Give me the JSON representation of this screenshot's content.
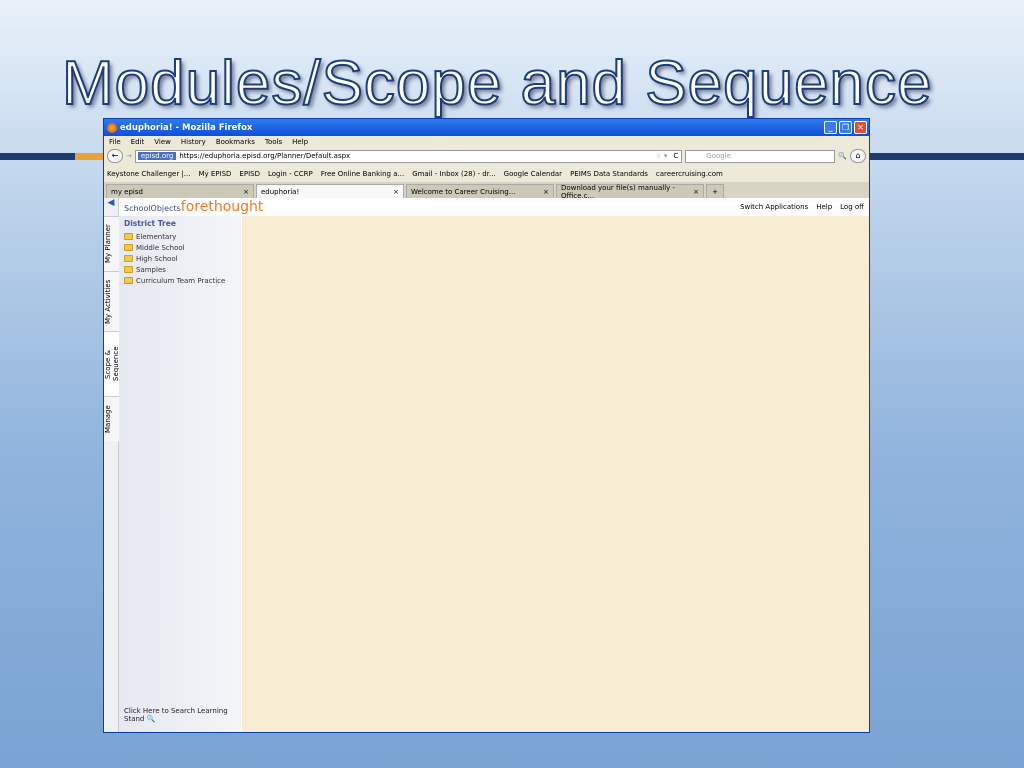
{
  "slide": {
    "title": "Modules/Scope and Sequence"
  },
  "window": {
    "title": "eduphoria! - Mozilla Firefox"
  },
  "menu": [
    "File",
    "Edit",
    "View",
    "History",
    "Bookmarks",
    "Tools",
    "Help"
  ],
  "nav": {
    "site": "episd.org",
    "url": "https://eduphoria.episd.org/Planner/Default.aspx",
    "search_placeholder": "Google"
  },
  "bookmarks": [
    "Keystone Challenger |...",
    "My EPISD",
    "EPISD",
    "Login - CCRP",
    "Free Online Banking a...",
    "Gmail - Inbox (28) - dr...",
    "Google Calendar",
    "PEIMS Data Standards",
    "careercruising.com"
  ],
  "tabs": [
    {
      "label": "my episd"
    },
    {
      "label": "eduphoria!"
    },
    {
      "label": "Welcome to Career Cruising..."
    },
    {
      "label": "Download your file(s) manually - Office.c..."
    }
  ],
  "app": {
    "logo_small": "SchoolObjects",
    "logo_big": "forethought",
    "switch": "Switch Applications",
    "help": "Help",
    "logoff": "Log off"
  },
  "vtabs": [
    "My Planner",
    "My Activities",
    "Scope & Sequence",
    "Manage"
  ],
  "tree": {
    "heading": "District Tree",
    "nodes": [
      "Elementary",
      "Middle School",
      "High School",
      "Samples",
      "Curriculum Team Practice"
    ],
    "search_link": "Click Here to Search Learning Stand"
  }
}
